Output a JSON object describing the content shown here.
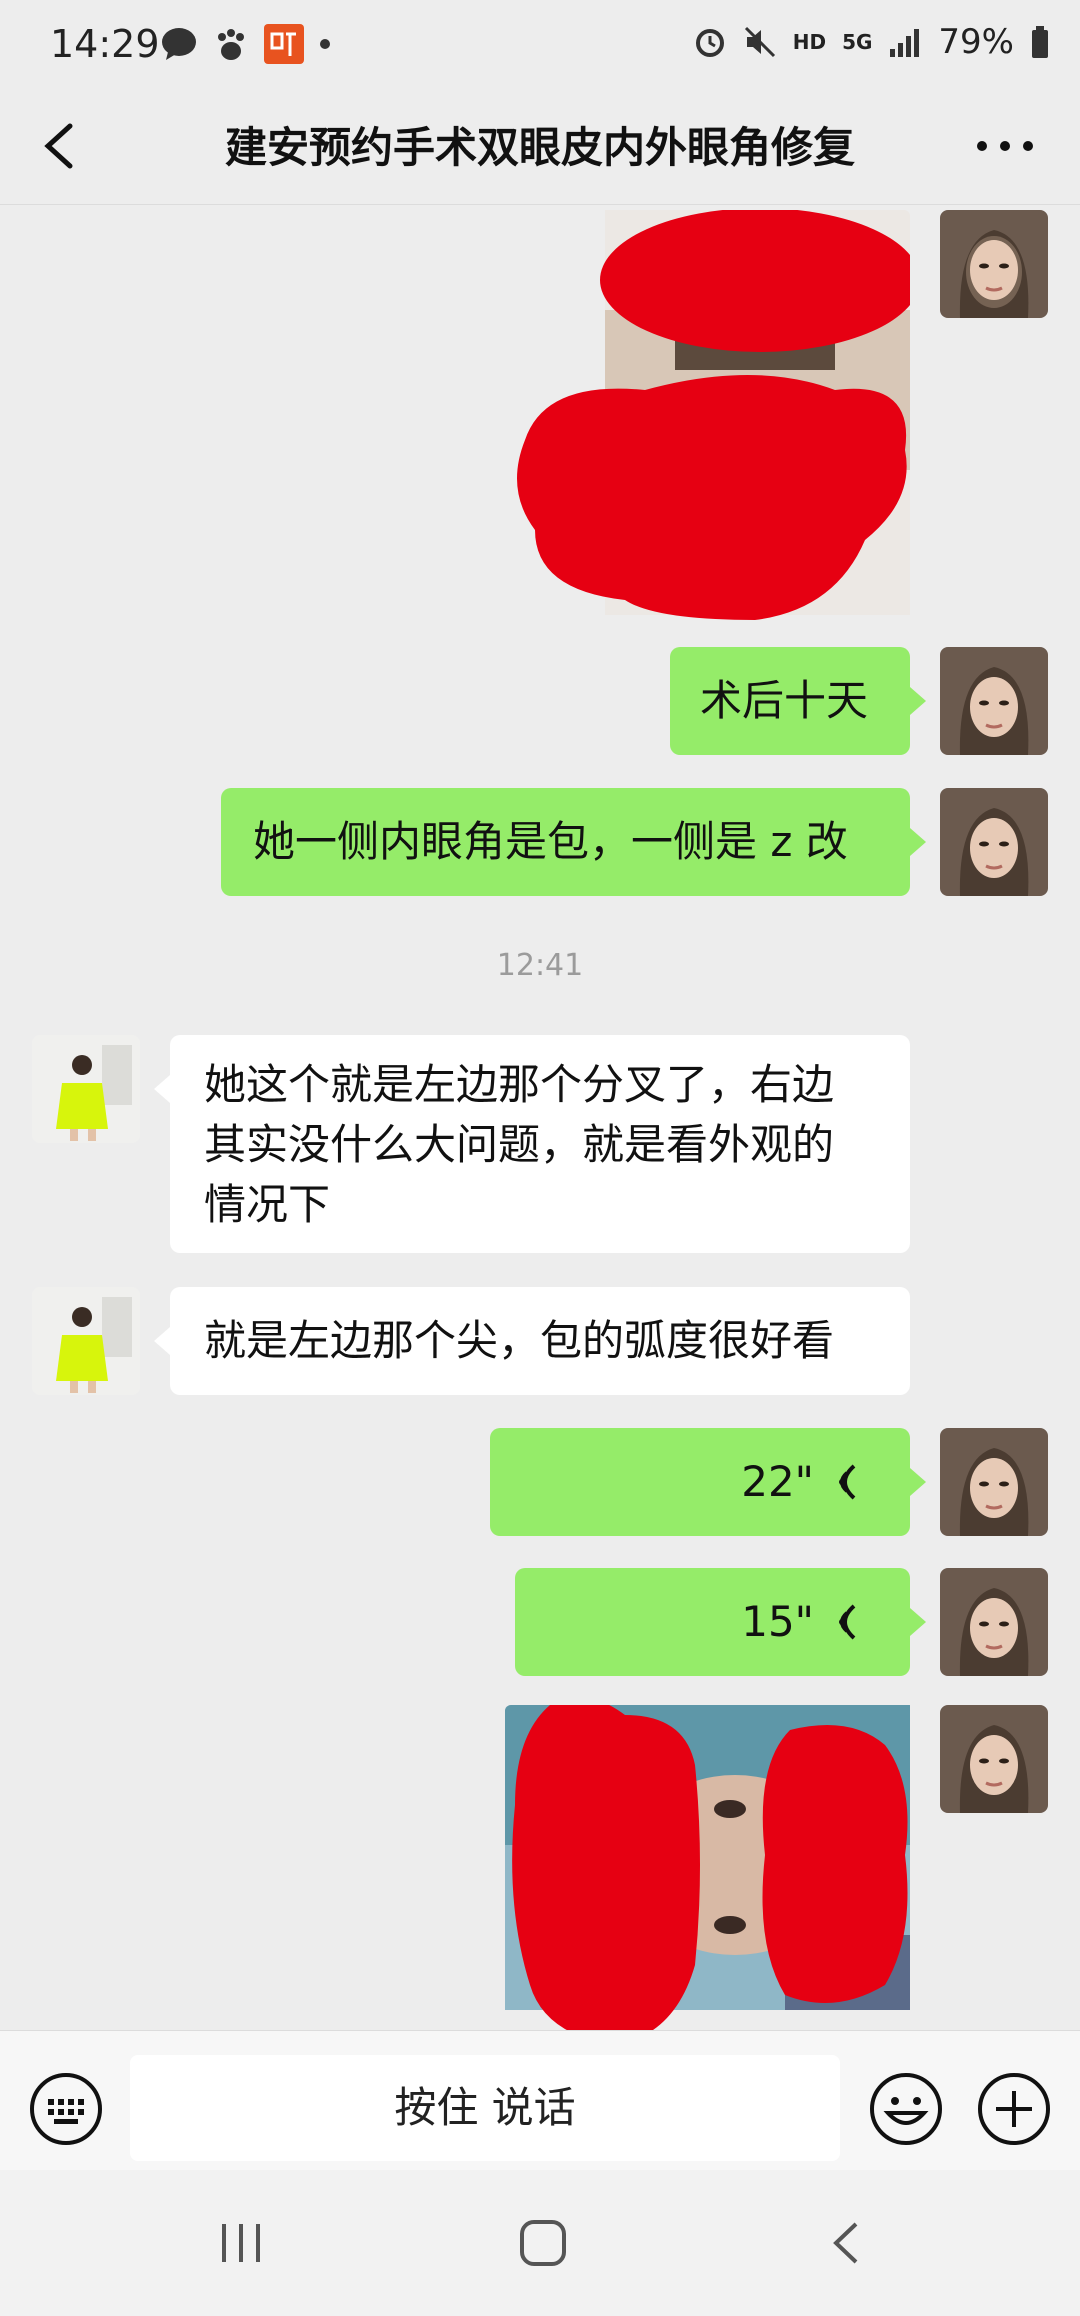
{
  "status_bar": {
    "time": "14:29",
    "network": "HD",
    "signal_label": "5G",
    "battery": "79%"
  },
  "chat": {
    "title": "建安预约手术双眼皮内外眼角修复",
    "timestamp": "12:41",
    "messages": {
      "m1": "术后十天",
      "m2": "她一侧内眼角是包，一侧是 z 改",
      "m3_line1": "她这个就是左边那个分叉了，右边",
      "m3_line2": "其实没什么大问题，就是看外观的",
      "m3_line3": "情况下",
      "m4": "就是左边那个尖，包的弧度很好看",
      "v1": "22\"",
      "v2": "15\""
    }
  },
  "input": {
    "press_to_talk": "按住 说话"
  },
  "icons": {
    "back": "chevron-left-icon",
    "more": "more-dots-icon",
    "keyboard": "keyboard-icon",
    "emoji": "emoji-icon",
    "plus": "plus-icon",
    "voice": "voice-wave-icon"
  },
  "colors": {
    "outgoing_bubble": "#95ec69",
    "incoming_bubble": "#ffffff",
    "redaction": "#e60012"
  }
}
